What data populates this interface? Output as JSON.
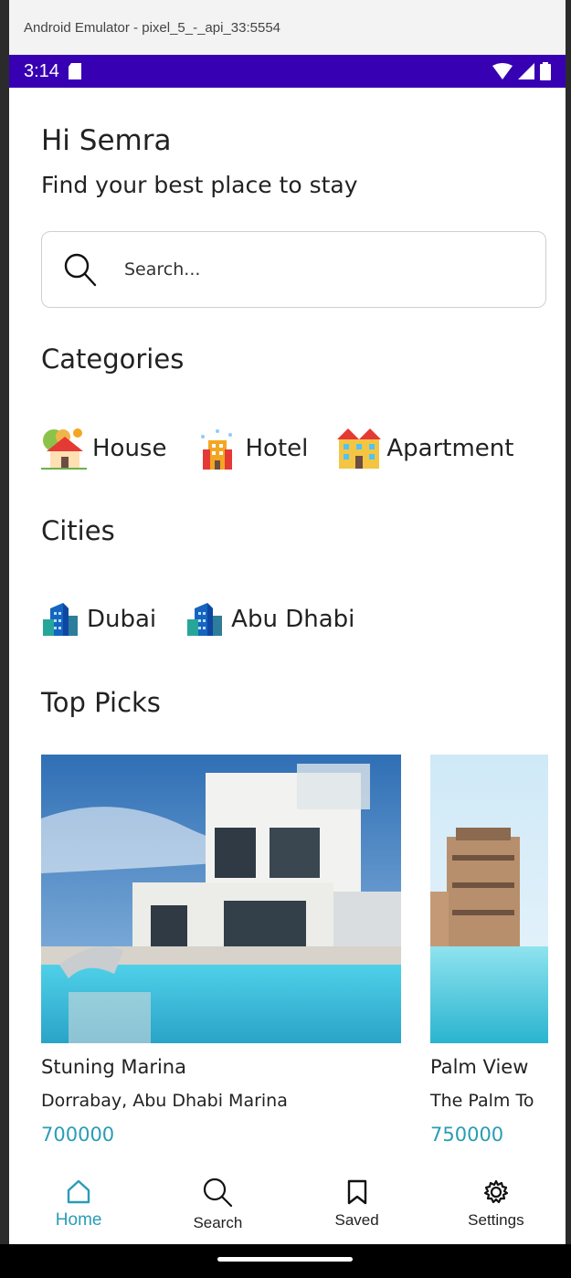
{
  "window": {
    "title": "Android Emulator - pixel_5_-_api_33:5554"
  },
  "status_bar": {
    "time": "3:14"
  },
  "header": {
    "greeting": "Hi Semra",
    "subtitle": "Find your best place to stay"
  },
  "search": {
    "placeholder": "Search..."
  },
  "categories": {
    "title": "Categories",
    "items": [
      {
        "label": "House",
        "icon": "house-icon"
      },
      {
        "label": "Hotel",
        "icon": "hotel-icon"
      },
      {
        "label": "Apartment",
        "icon": "apartment-icon"
      }
    ]
  },
  "cities": {
    "title": "Cities",
    "items": [
      {
        "label": "Dubai",
        "icon": "city-building-icon"
      },
      {
        "label": "Abu Dhabi",
        "icon": "city-building-icon"
      }
    ]
  },
  "top_picks": {
    "title": "Top Picks",
    "items": [
      {
        "name": "Stuning Marina",
        "location": "Dorrabay, Abu Dhabi Marina",
        "price": "700000"
      },
      {
        "name": "Palm View",
        "location": "The Palm To",
        "price": "750000"
      }
    ]
  },
  "bottom_nav": {
    "items": [
      {
        "label": "Home",
        "icon": "home-icon",
        "active": true
      },
      {
        "label": "Search",
        "icon": "search-icon",
        "active": false
      },
      {
        "label": "Saved",
        "icon": "bookmark-icon",
        "active": false
      },
      {
        "label": "Settings",
        "icon": "gear-icon",
        "active": false
      }
    ]
  },
  "colors": {
    "status_bar": "#3700b3",
    "accent": "#2a9cb7"
  }
}
